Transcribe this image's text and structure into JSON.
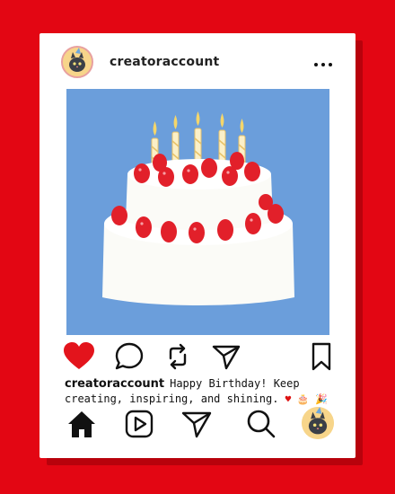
{
  "post": {
    "username": "creatoraccount",
    "caption_user": "creatoraccount",
    "caption_text": "Happy Birthday! Keep creating, inspiring, and shining.",
    "caption_emojis": "♥ 🎂 🎉"
  },
  "icons": {
    "more": "more-options-icon",
    "like": "heart-filled-icon",
    "comment": "comment-bubble-icon",
    "repost": "repost-icon",
    "share": "paper-plane-icon",
    "save": "bookmark-icon",
    "home": "home-icon",
    "reels": "reels-play-icon",
    "messages": "paper-plane-icon",
    "search": "search-icon",
    "profile": "avatar"
  },
  "colors": {
    "background": "#e30613",
    "like": "#e3141c",
    "photo_bg": "#6b9edb"
  }
}
